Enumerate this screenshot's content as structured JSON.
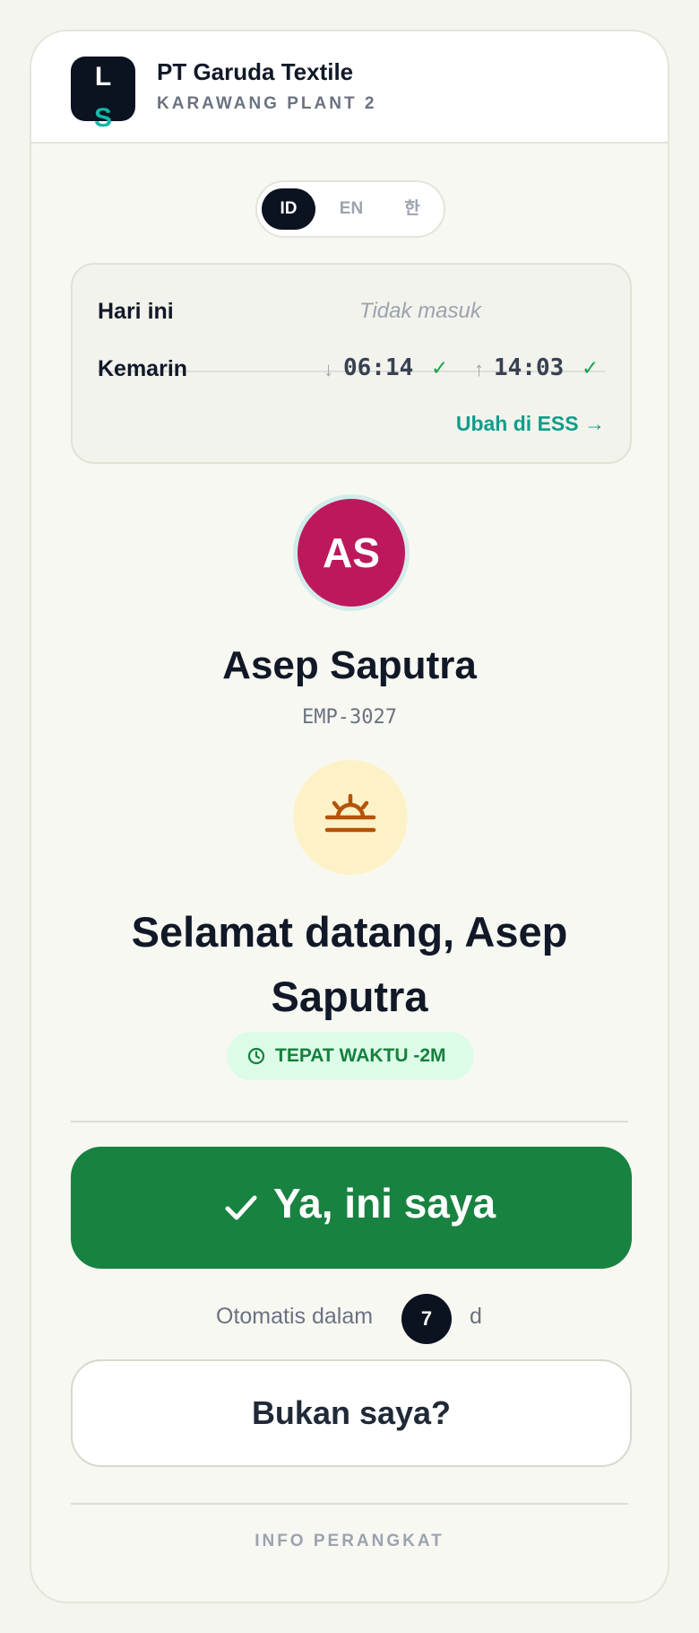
{
  "header": {
    "logo_top": "L",
    "logo_bottom": "S",
    "company": "PT Garuda Textile",
    "plant": "KARAWANG PLANT 2"
  },
  "language": {
    "options": [
      "ID",
      "EN",
      "한"
    ],
    "selected": "ID"
  },
  "attendance": {
    "today_label": "Hari ini",
    "today_status": "Tidak masuk",
    "yesterday_label": "Kemarin",
    "in_arrow": "↓",
    "in_time": "06:14",
    "out_arrow": "↑",
    "out_time": "14:03",
    "check": "✓",
    "edit_link": "Ubah di ESS →"
  },
  "employee": {
    "initials": "AS",
    "name": "Asep Saputra",
    "id": "EMP-3027",
    "avatar_color": "#be185d"
  },
  "greeting": {
    "icon": "sunrise-icon",
    "text": "Selamat datang, Asep Saputra"
  },
  "status_badge": {
    "icon": "clock-icon",
    "text": "TEPAT WAKTU -2M"
  },
  "actions": {
    "confirm_label": "Ya, ini saya",
    "auto_text": "Otomatis dalam",
    "countdown": "7",
    "countdown_unit": "d",
    "not_me_label": "Bukan saya?"
  },
  "footer": {
    "device_info": "INFO PERANGKAT"
  },
  "colors": {
    "primary_green": "#188241",
    "accent_teal": "#0f9d8a",
    "dark": "#0b1220"
  }
}
